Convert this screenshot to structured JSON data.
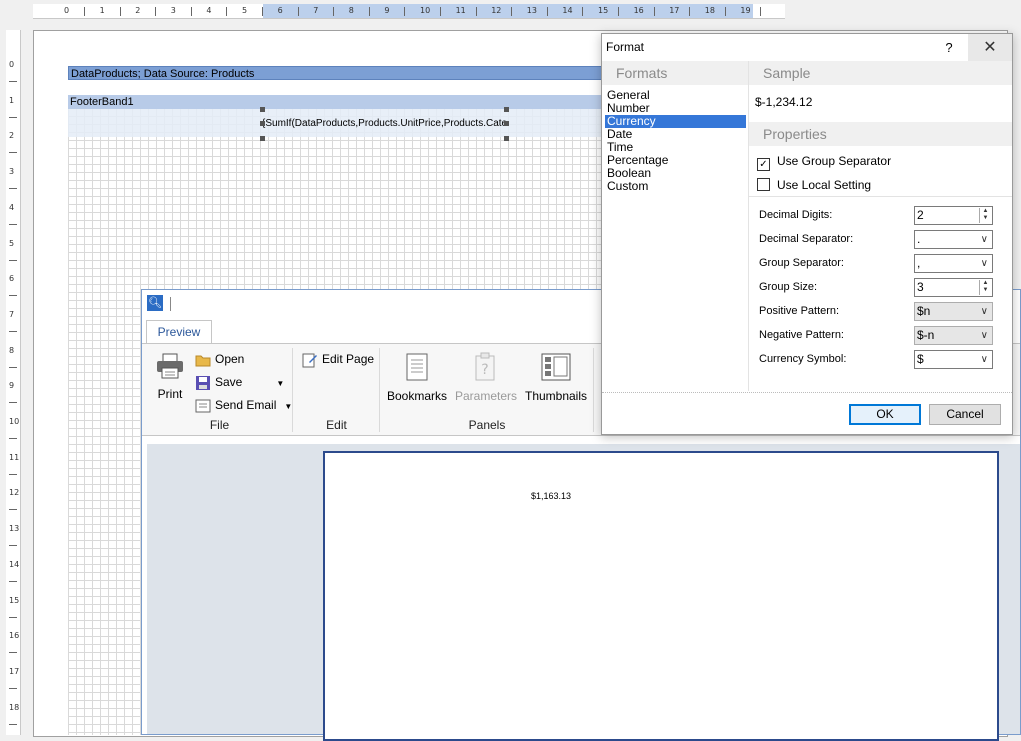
{
  "ruler": {
    "h_ticks": [
      "0",
      "1",
      "2",
      "3",
      "4",
      "5",
      "6",
      "7",
      "8",
      "9",
      "10",
      "11",
      "12",
      "13",
      "14",
      "15",
      "16",
      "17",
      "18",
      "19"
    ],
    "v_ticks": [
      "0",
      "1",
      "2",
      "3",
      "4",
      "5",
      "6",
      "7",
      "8",
      "9",
      "10",
      "11",
      "12",
      "13",
      "14",
      "15",
      "16",
      "17",
      "18"
    ]
  },
  "designer": {
    "data_band_title": "DataProducts; Data Source: Products",
    "footer_band_title": "FooterBand1",
    "expression": "{SumIf(DataProducts,Products.UnitPrice,Products.CategoryID > 3)}"
  },
  "preview": {
    "tab_label": "Preview",
    "file_group": {
      "label": "File",
      "print_label": "Print",
      "open_label": "Open",
      "save_label": "Save",
      "send_email_label": "Send Email"
    },
    "edit_group": {
      "label": "Edit",
      "edit_page_label": "Edit Page"
    },
    "panels_group": {
      "label": "Panels",
      "bookmarks_label": "Bookmarks",
      "parameters_label": "Parameters",
      "thumbnails_label": "Thumbnails"
    },
    "document_value": "$1,163.13"
  },
  "dialog": {
    "title": "Format",
    "help_label": "?",
    "close_label": "✕",
    "formats_header": "Formats",
    "formats": [
      "General",
      "Number",
      "Currency",
      "Date",
      "Time",
      "Percentage",
      "Boolean",
      "Custom"
    ],
    "selected_format": "Currency",
    "sample_header": "Sample",
    "sample_value": "$-1,234.12",
    "properties_header": "Properties",
    "use_group_separator_label": "Use Group Separator",
    "use_group_separator_checked": true,
    "use_local_setting_label": "Use Local Setting",
    "use_local_setting_checked": false,
    "props": {
      "decimal_digits_label": "Decimal Digits:",
      "decimal_digits_value": "2",
      "decimal_separator_label": "Decimal Separator:",
      "decimal_separator_value": ".",
      "group_separator_label": "Group Separator:",
      "group_separator_value": ",",
      "group_size_label": "Group Size:",
      "group_size_value": "3",
      "positive_pattern_label": "Positive Pattern:",
      "positive_pattern_value": "$n",
      "negative_pattern_label": "Negative Pattern:",
      "negative_pattern_value": "$-n",
      "currency_symbol_label": "Currency Symbol:",
      "currency_symbol_value": "$"
    },
    "ok_label": "OK",
    "cancel_label": "Cancel"
  }
}
